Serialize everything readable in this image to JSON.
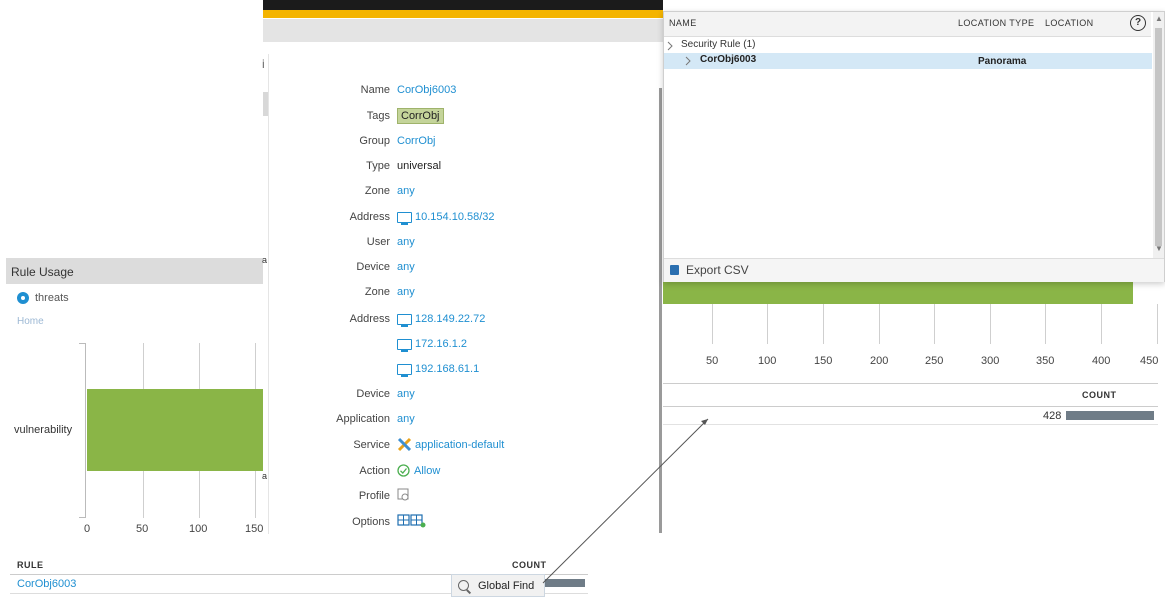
{
  "detail": {
    "fields": [
      {
        "label": "Name",
        "value": "CorObj6003"
      },
      {
        "label": "Tags",
        "value": "CorrObj"
      },
      {
        "label": "Group",
        "value": "CorrObj"
      },
      {
        "label": "Type",
        "value": "universal"
      },
      {
        "label": "Zone",
        "value": "any"
      },
      {
        "label": "Address",
        "value": "10.154.10.58/32"
      },
      {
        "label": "User",
        "value": "any"
      },
      {
        "label": "Device",
        "value": "any"
      },
      {
        "label": "Zone",
        "value": "any"
      },
      {
        "label": "Address",
        "value": "128.149.22.72"
      },
      {
        "label": "",
        "value": "172.16.1.2"
      },
      {
        "label": "",
        "value": "192.168.61.1"
      },
      {
        "label": "Device",
        "value": "any"
      },
      {
        "label": "Application",
        "value": "any"
      },
      {
        "label": "Service",
        "value": "application-default"
      },
      {
        "label": "Action",
        "value": "Allow"
      },
      {
        "label": "Profile",
        "value": ""
      },
      {
        "label": "Options",
        "value": ""
      }
    ]
  },
  "rule_usage": {
    "title": "Rule Usage",
    "radio_label": "threats",
    "breadcrumb": "Home",
    "chart_data": {
      "type": "bar",
      "orientation": "horizontal",
      "categories": [
        "vulnerability"
      ],
      "values": [
        428
      ],
      "xticks": [
        "0",
        "50",
        "100",
        "150"
      ]
    },
    "table": {
      "headers": [
        "RULE",
        "COUNT"
      ],
      "rows": [
        {
          "rule": "CorObj6003"
        }
      ]
    }
  },
  "global_find": {
    "label": "Global Find"
  },
  "right_chart": {
    "xticks": [
      "50",
      "100",
      "150",
      "200",
      "250",
      "300",
      "350",
      "400",
      "450"
    ],
    "count_header": "COUNT",
    "count_value": "428"
  },
  "results": {
    "columns": [
      "NAME",
      "LOCATION TYPE",
      "LOCATION"
    ],
    "help": "?",
    "group": "Security Rule (1)",
    "row": {
      "name": "CorObj6003",
      "location": "Panorama"
    },
    "export": "Export CSV"
  },
  "background": {
    "cut_text": "i"
  },
  "colors": {
    "accent": "#1f8fd1",
    "bar": "#8ab547",
    "tag": "#c4d49a",
    "header_yellow": "#f4b400"
  }
}
